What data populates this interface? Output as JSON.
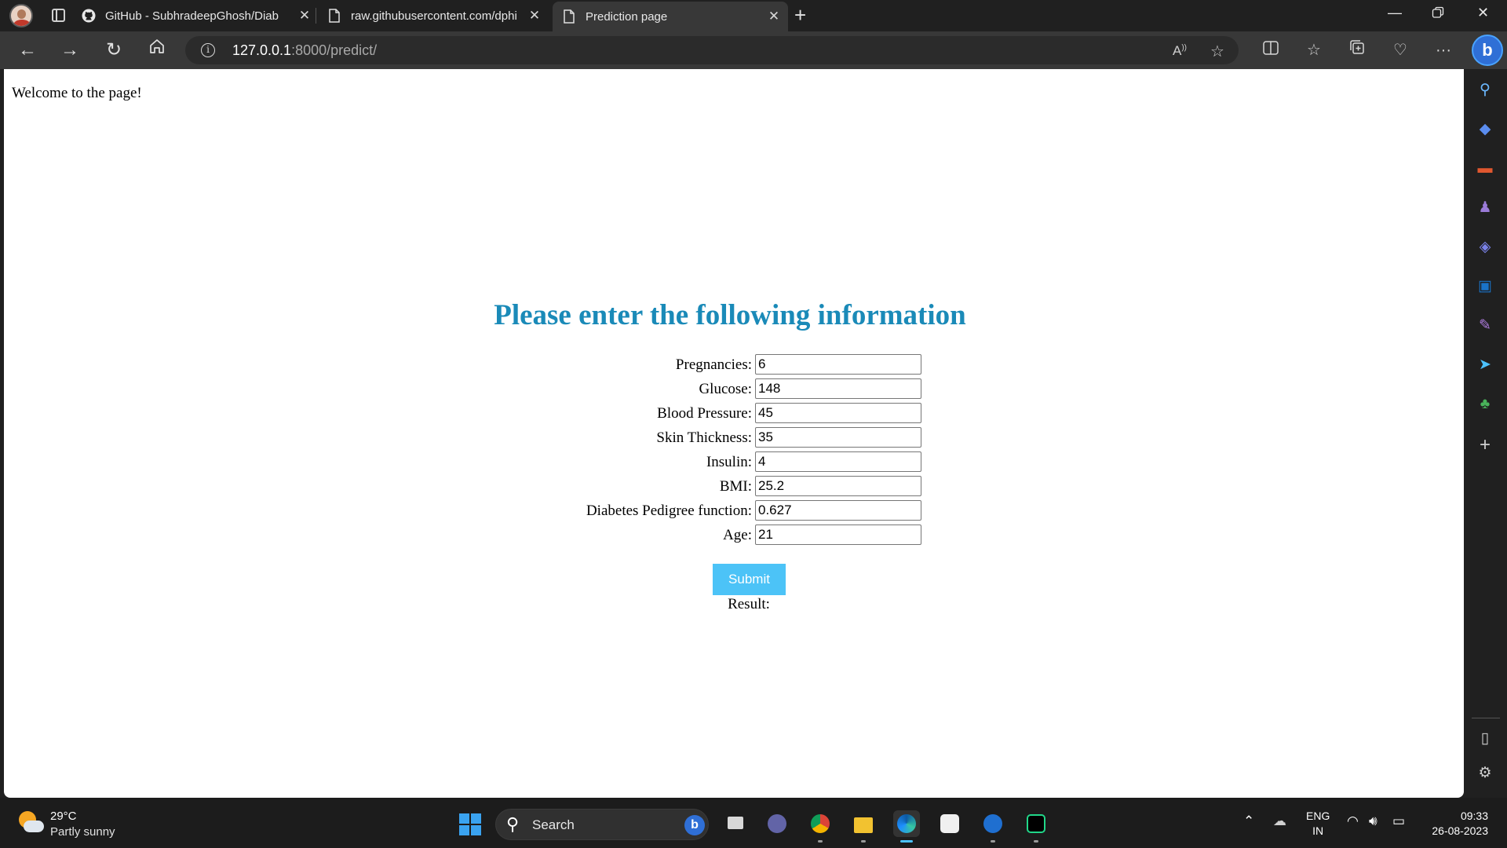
{
  "browser": {
    "tabs": [
      {
        "title": "GitHub - SubhradeepGhosh/Diab",
        "icon": "github-icon"
      },
      {
        "title": "raw.githubusercontent.com/dphi",
        "icon": "page-icon"
      },
      {
        "title": "Prediction page",
        "icon": "page-icon",
        "active": true
      }
    ],
    "url_host": "127.0.0.1",
    "url_rest": ":8000/predict/",
    "read_aloud": "A)"
  },
  "page": {
    "welcome": "Welcome to the page!",
    "heading": "Please enter the following information",
    "fields": [
      {
        "label": "Pregnancies:",
        "value": "6"
      },
      {
        "label": "Glucose:",
        "value": "148"
      },
      {
        "label": "Blood Pressure:",
        "value": "45"
      },
      {
        "label": "Skin Thickness:",
        "value": "35"
      },
      {
        "label": "Insulin:",
        "value": "4"
      },
      {
        "label": "BMI:",
        "value": "25.2"
      },
      {
        "label": "Diabetes Pedigree function:",
        "value": "0.627"
      },
      {
        "label": "Age:",
        "value": "21"
      }
    ],
    "submit_label": "Submit",
    "result_label": "Result:"
  },
  "taskbar": {
    "temperature": "29°C",
    "condition": "Partly sunny",
    "search_label": "Search",
    "lang_line1": "ENG",
    "lang_line2": "IN",
    "time": "09:33",
    "date": "26-08-2023"
  },
  "colors": {
    "heading": "#1a8ab8",
    "submit_bg": "#4cc3f7",
    "accent": "#4cc2ff"
  }
}
